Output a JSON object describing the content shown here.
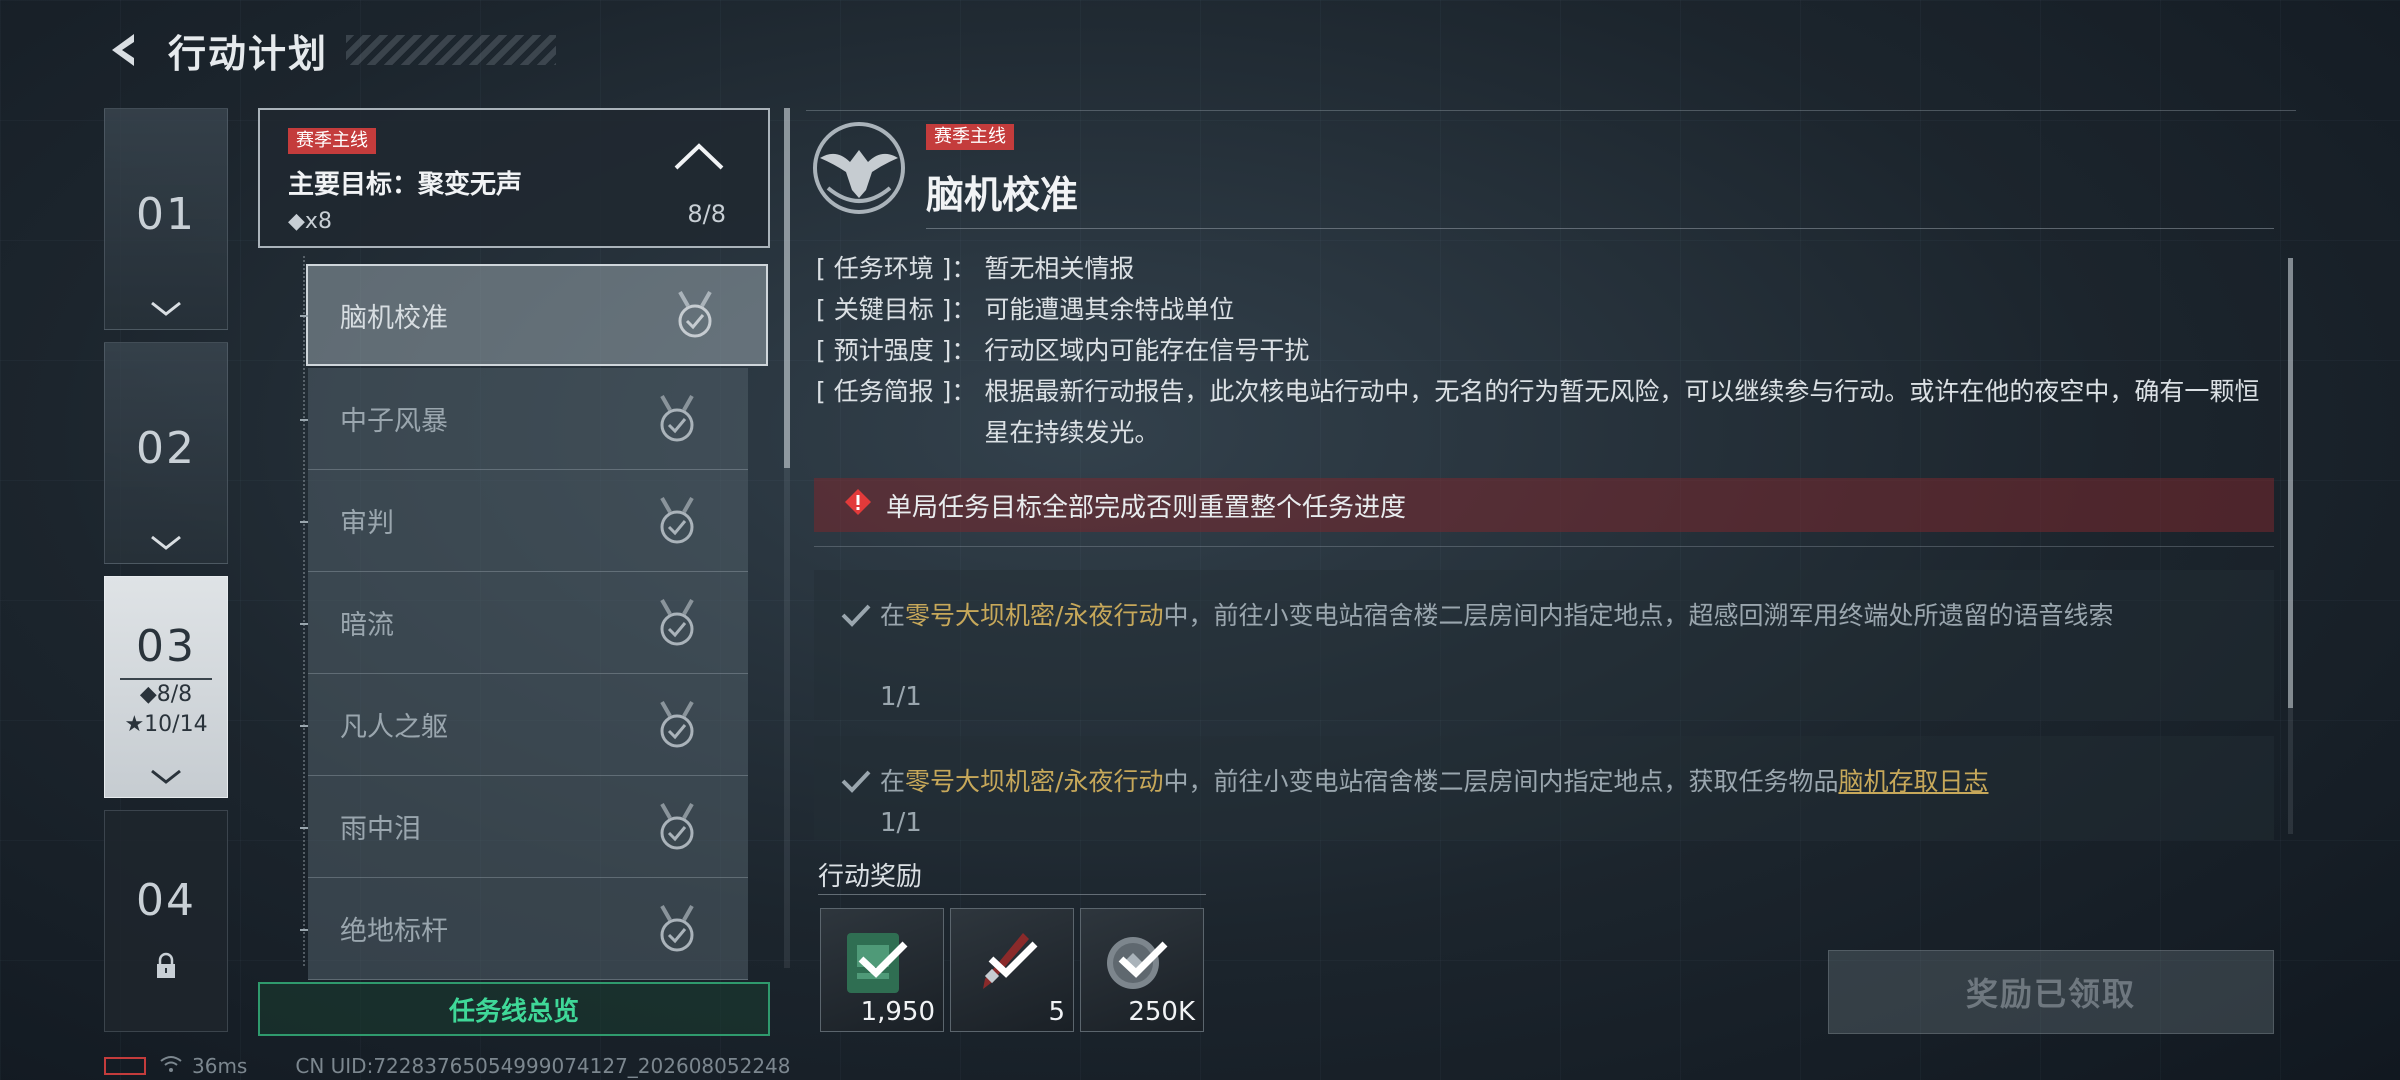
{
  "header": {
    "title": "行动计划"
  },
  "chapters": [
    {
      "num": "01",
      "state": "collapsed"
    },
    {
      "num": "02",
      "state": "collapsed"
    },
    {
      "num": "03",
      "state": "active",
      "diamond_progress": "◆8/8",
      "star_progress": "★10/14"
    },
    {
      "num": "04",
      "state": "locked"
    }
  ],
  "main_goal": {
    "tag": "赛季主线",
    "title": "主要目标：聚变无声",
    "count": "◆x8",
    "progress": "8/8"
  },
  "quests": [
    {
      "name": "脑机校准",
      "completed": true,
      "selected": true
    },
    {
      "name": "中子风暴",
      "completed": true
    },
    {
      "name": "审判",
      "completed": true
    },
    {
      "name": "暗流",
      "completed": true
    },
    {
      "name": "凡人之躯",
      "completed": true
    },
    {
      "name": "雨中泪",
      "completed": true
    },
    {
      "name": "绝地标杆",
      "completed": true
    }
  ],
  "overview_button": "任务线总览",
  "detail": {
    "tag": "赛季主线",
    "title": "脑机校准",
    "info": [
      {
        "label": "任务环境",
        "value": "暂无相关情报"
      },
      {
        "label": "关键目标",
        "value": "可能遭遇其余特战单位"
      },
      {
        "label": "预计强度",
        "value": "行动区域内可能存在信号干扰"
      },
      {
        "label": "任务简报",
        "value": "根据最新行动报告，此次核电站行动中，无名的行为暂无风险，可以继续参与行动。或许在他的夜空中，确有一颗恒星在持续发光。"
      }
    ],
    "warning": "单局任务目标全部完成否则重置整个任务进度",
    "objectives": [
      {
        "pre": "在",
        "highlight": "零号大坝机密/永夜行动",
        "post": "中，前往小变电站宿舍楼二层房间内指定地点，超感回溯军用终端处所遗留的语音线索",
        "link": "",
        "progress": "1/1"
      },
      {
        "pre": "在",
        "highlight": "零号大坝机密/永夜行动",
        "post": "中，前往小变电站宿舍楼二层房间内指定地点，获取任务物品",
        "link": "脑机存取日志",
        "progress": "1/1"
      }
    ]
  },
  "rewards": {
    "label": "行动奖励",
    "items": [
      {
        "icon": "card-item-icon",
        "qty": "1,950"
      },
      {
        "icon": "syringe-item-icon",
        "qty": "5"
      },
      {
        "icon": "coin-item-icon",
        "qty": "250K"
      }
    ]
  },
  "claim_button": "奖励已领取",
  "status": {
    "ping": "36ms",
    "uid": "CN UID:72283765054999074127_202608052248"
  },
  "colors": {
    "tag_red": "#c43c3c",
    "accent_green": "#3fd898",
    "highlight_gold": "#c7a85a"
  }
}
